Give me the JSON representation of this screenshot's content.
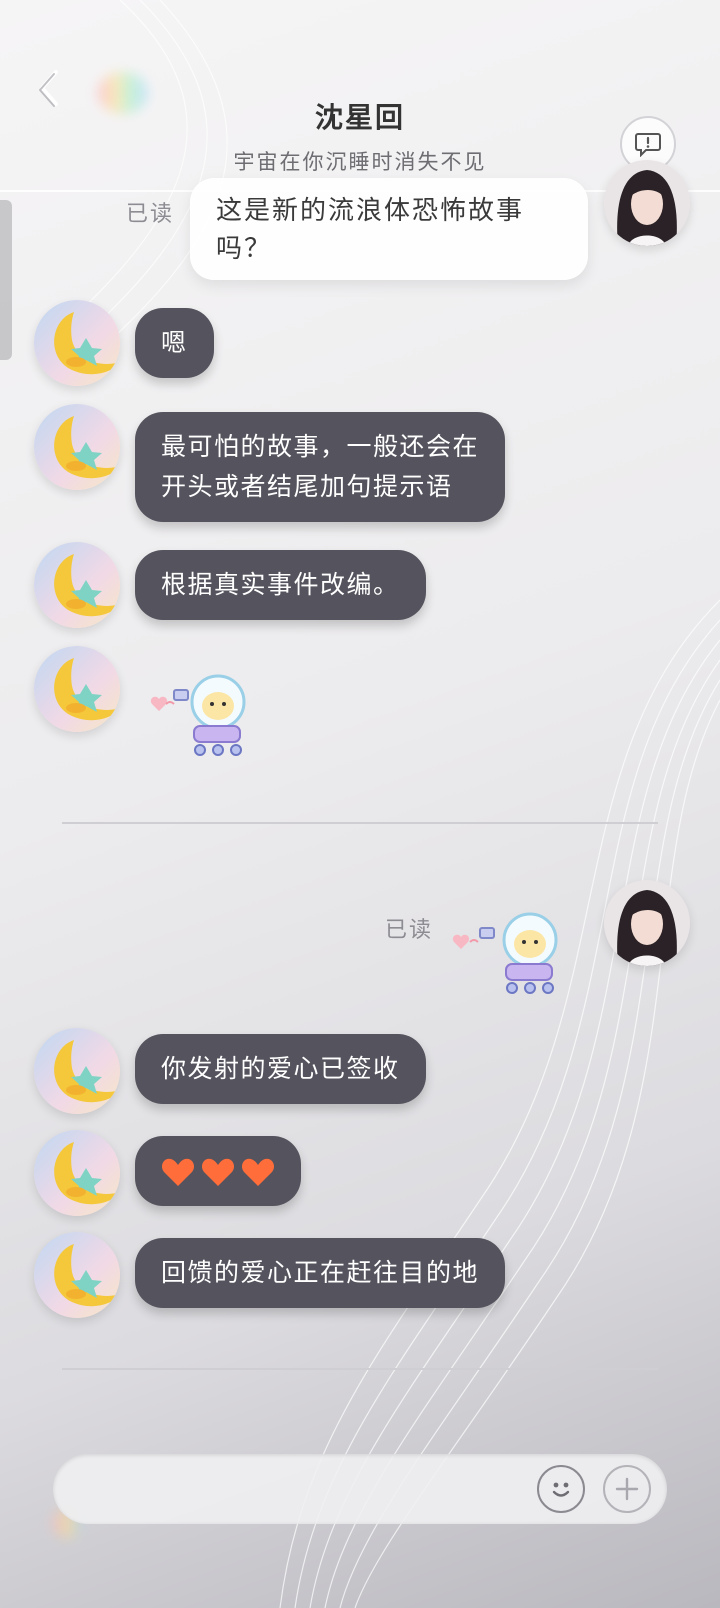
{
  "header": {
    "title": "沈星回",
    "subtitle": "宇宙在你沉睡时消失不见"
  },
  "messages": {
    "self_top": {
      "read": "已读",
      "text": "这是新的流浪体恐怖故事吗？"
    },
    "m1": "嗯",
    "m2_line1": "最可怕的故事，一般还会在",
    "m2_line2": "开头或者结尾加句提示语",
    "m3": "根据真实事件改编。",
    "self_sticker_read": "已读",
    "m5": "你发射的爱心已签收",
    "m6_hearts": "heart-icon x3",
    "m7": "回馈的爱心正在赶往目的地"
  },
  "input": {
    "placeholder": ""
  },
  "colors": {
    "bubble_other": "#55535d",
    "bubble_self": "#ffffff",
    "heart": "#ff6d3a",
    "background": "#ecebed"
  },
  "icons": {
    "back": "chevron-left-icon",
    "tips": "chat-tip-icon",
    "emoji": "smile-icon",
    "plus": "plus-icon"
  }
}
